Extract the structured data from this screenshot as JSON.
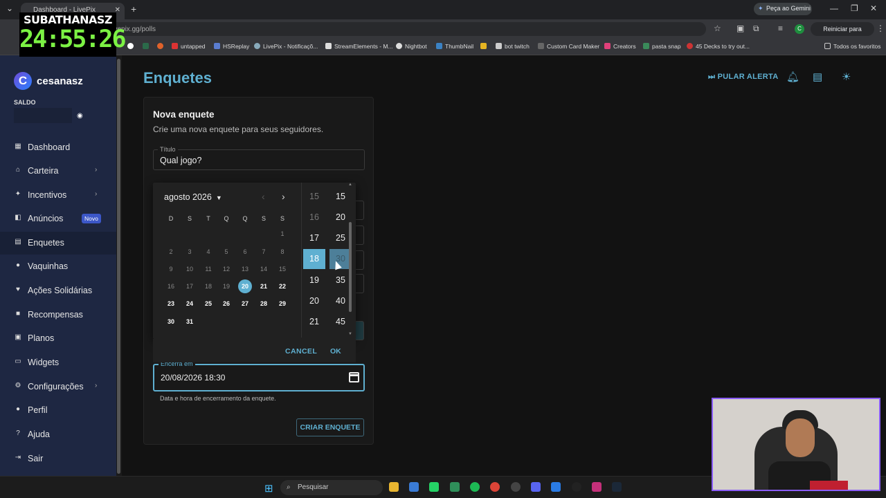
{
  "browser": {
    "tab_title": "Dashboard - LivePix",
    "url": "livepix.gg/polls",
    "gemini_label": "Peça ao Gemini",
    "restart_label": "Reiniciar para atualizar",
    "profile_initial": "C",
    "bookmarks": [
      "untapped",
      "HSReplay",
      "LivePix - Notificaçõ...",
      "StreamElements - M...",
      "Nightbot",
      "ThumbNail",
      "bot twitch",
      "Custom Card Maker",
      "Creators",
      "pasta snap",
      "45 Decks to try out..."
    ],
    "all_bookmarks": "Todos os favoritos"
  },
  "overlay": {
    "name": "SUBATHANASZ",
    "timer": "24:55:26"
  },
  "sidebar": {
    "username": "cesanasz",
    "logo_letter": "C",
    "saldo_label": "SALDO",
    "items": [
      {
        "label": "Dashboard",
        "icon": "grid-icon"
      },
      {
        "label": "Carteira",
        "icon": "bank-icon"
      },
      {
        "label": "Incentivos",
        "icon": "sparkle-icon"
      },
      {
        "label": "Anúncios",
        "icon": "megaphone-icon",
        "badge": "Novo"
      },
      {
        "label": "Enquetes",
        "icon": "poll-icon"
      },
      {
        "label": "Vaquinhas",
        "icon": "piggy-icon"
      },
      {
        "label": "Ações Solidárias",
        "icon": "heart-hand-icon"
      },
      {
        "label": "Recompensas",
        "icon": "gift-icon"
      },
      {
        "label": "Planos",
        "icon": "plans-icon"
      },
      {
        "label": "Widgets",
        "icon": "widgets-icon"
      },
      {
        "label": "Configurações",
        "icon": "gear-icon"
      },
      {
        "label": "Perfil",
        "icon": "user-icon"
      },
      {
        "label": "Ajuda",
        "icon": "help-icon"
      },
      {
        "label": "Sair",
        "icon": "logout-icon"
      }
    ]
  },
  "header": {
    "title": "Enquetes",
    "skip_alert": "PULAR ALERTA"
  },
  "form": {
    "title": "Nova enquete",
    "subtitle": "Crie uma nova enquete para seus seguidores.",
    "title_label": "Título",
    "title_value": "Qual jogo?",
    "end_label": "Encerra em",
    "end_value": "20/08/2026 18:30",
    "end_hint": "Data e hora de encerramento da enquete.",
    "submit": "CRIAR ENQUETE"
  },
  "picker": {
    "month_label": "agosto 2026",
    "weekdays": [
      "D",
      "S",
      "T",
      "Q",
      "Q",
      "S",
      "S"
    ],
    "days": [
      "1",
      "2",
      "3",
      "4",
      "5",
      "6",
      "7",
      "8",
      "9",
      "10",
      "11",
      "12",
      "13",
      "14",
      "15",
      "16",
      "17",
      "18",
      "19",
      "20",
      "21",
      "22",
      "23",
      "24",
      "25",
      "26",
      "27",
      "28",
      "29",
      "30",
      "31"
    ],
    "selected_day": "20",
    "hours": [
      "15",
      "16",
      "17",
      "18",
      "19",
      "20",
      "21"
    ],
    "selected_hour": "18",
    "minutes": [
      "15",
      "20",
      "25",
      "30",
      "35",
      "40",
      "45"
    ],
    "selected_minute": "30",
    "cancel": "CANCEL",
    "ok": "OK"
  },
  "taskbar": {
    "search_placeholder": "Pesquisar"
  }
}
